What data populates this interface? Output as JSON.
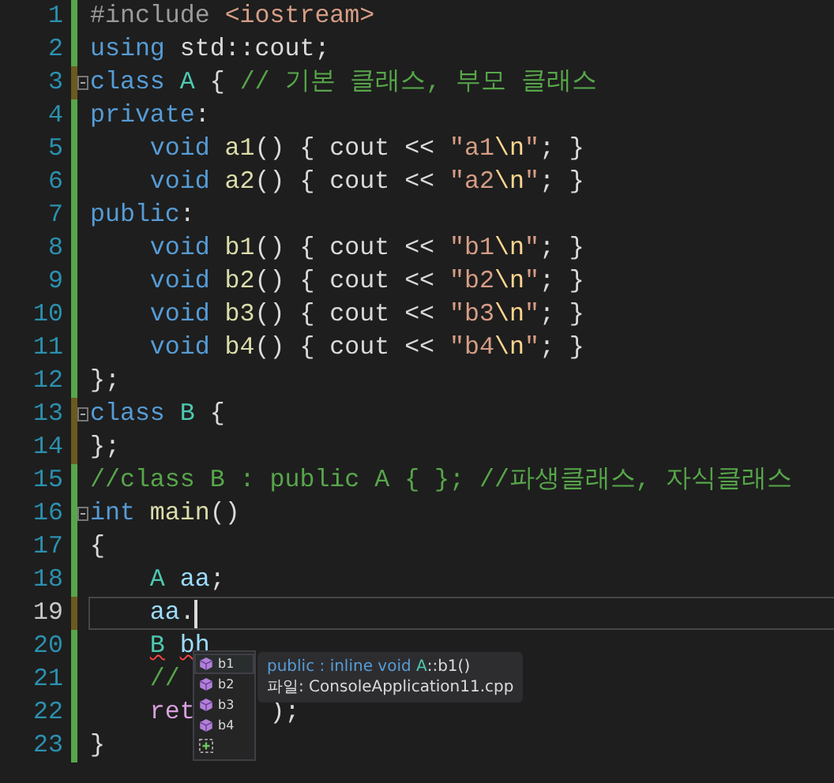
{
  "editor": {
    "lines": [
      {
        "number": "1",
        "saved": true,
        "fold": false,
        "current": false,
        "indent": false,
        "tokens": [
          {
            "text": "#include",
            "kind": "pre"
          },
          {
            "text": " <iostream>",
            "kind": "string"
          }
        ]
      },
      {
        "number": "2",
        "saved": true,
        "fold": false,
        "current": false,
        "indent": false,
        "tokens": [
          {
            "text": "using",
            "kind": "keyword"
          },
          {
            "text": " std::cout;",
            "kind": "plain"
          }
        ]
      },
      {
        "number": "3",
        "saved": false,
        "fold": true,
        "current": false,
        "indent": false,
        "tokens": [
          {
            "text": "class",
            "kind": "keyword"
          },
          {
            "text": " A",
            "kind": "type"
          },
          {
            "text": " { ",
            "kind": "plain"
          },
          {
            "text": "// 기본 클래스, 부모 클래스",
            "kind": "comment"
          }
        ]
      },
      {
        "number": "4",
        "saved": true,
        "fold": false,
        "current": false,
        "indent": false,
        "tokens": [
          {
            "text": "private",
            "kind": "keyword"
          },
          {
            "text": ":",
            "kind": "plain"
          }
        ]
      },
      {
        "number": "5",
        "saved": true,
        "fold": false,
        "current": false,
        "indent": true,
        "tokens": [
          {
            "text": "void",
            "kind": "keyword"
          },
          {
            "text": " a1",
            "kind": "function"
          },
          {
            "text": "() { cout << ",
            "kind": "plain"
          },
          {
            "text": "\"a1",
            "kind": "string"
          },
          {
            "text": "\\n",
            "kind": "escape"
          },
          {
            "text": "\"",
            "kind": "string"
          },
          {
            "text": "; }",
            "kind": "plain"
          }
        ]
      },
      {
        "number": "6",
        "saved": true,
        "fold": false,
        "current": false,
        "indent": true,
        "tokens": [
          {
            "text": "void",
            "kind": "keyword"
          },
          {
            "text": " a2",
            "kind": "function"
          },
          {
            "text": "() { cout << ",
            "kind": "plain"
          },
          {
            "text": "\"a2",
            "kind": "string"
          },
          {
            "text": "\\n",
            "kind": "escape"
          },
          {
            "text": "\"",
            "kind": "string"
          },
          {
            "text": "; }",
            "kind": "plain"
          }
        ]
      },
      {
        "number": "7",
        "saved": true,
        "fold": false,
        "current": false,
        "indent": false,
        "tokens": [
          {
            "text": "public",
            "kind": "keyword"
          },
          {
            "text": ":",
            "kind": "plain"
          }
        ]
      },
      {
        "number": "8",
        "saved": true,
        "fold": false,
        "current": false,
        "indent": true,
        "tokens": [
          {
            "text": "void",
            "kind": "keyword"
          },
          {
            "text": " b1",
            "kind": "function"
          },
          {
            "text": "() { cout << ",
            "kind": "plain"
          },
          {
            "text": "\"b1",
            "kind": "string"
          },
          {
            "text": "\\n",
            "kind": "escape"
          },
          {
            "text": "\"",
            "kind": "string"
          },
          {
            "text": "; }",
            "kind": "plain"
          }
        ]
      },
      {
        "number": "9",
        "saved": true,
        "fold": false,
        "current": false,
        "indent": true,
        "tokens": [
          {
            "text": "void",
            "kind": "keyword"
          },
          {
            "text": " b2",
            "kind": "function"
          },
          {
            "text": "() { cout << ",
            "kind": "plain"
          },
          {
            "text": "\"b2",
            "kind": "string"
          },
          {
            "text": "\\n",
            "kind": "escape"
          },
          {
            "text": "\"",
            "kind": "string"
          },
          {
            "text": "; }",
            "kind": "plain"
          }
        ]
      },
      {
        "number": "10",
        "saved": true,
        "fold": false,
        "current": false,
        "indent": true,
        "tokens": [
          {
            "text": "void",
            "kind": "keyword"
          },
          {
            "text": " b3",
            "kind": "function"
          },
          {
            "text": "() { cout << ",
            "kind": "plain"
          },
          {
            "text": "\"b3",
            "kind": "string"
          },
          {
            "text": "\\n",
            "kind": "escape"
          },
          {
            "text": "\"",
            "kind": "string"
          },
          {
            "text": "; }",
            "kind": "plain"
          }
        ]
      },
      {
        "number": "11",
        "saved": true,
        "fold": false,
        "current": false,
        "indent": true,
        "tokens": [
          {
            "text": "void",
            "kind": "keyword"
          },
          {
            "text": " b4",
            "kind": "function"
          },
          {
            "text": "() { cout << ",
            "kind": "plain"
          },
          {
            "text": "\"b4",
            "kind": "string"
          },
          {
            "text": "\\n",
            "kind": "escape"
          },
          {
            "text": "\"",
            "kind": "string"
          },
          {
            "text": "; }",
            "kind": "plain"
          }
        ]
      },
      {
        "number": "12",
        "saved": true,
        "fold": false,
        "current": false,
        "indent": false,
        "tokens": [
          {
            "text": "};",
            "kind": "plain"
          }
        ]
      },
      {
        "number": "13",
        "saved": false,
        "fold": true,
        "current": false,
        "indent": false,
        "tokens": [
          {
            "text": "class",
            "kind": "keyword"
          },
          {
            "text": " B",
            "kind": "type"
          },
          {
            "text": " {",
            "kind": "plain"
          }
        ]
      },
      {
        "number": "14",
        "saved": false,
        "fold": false,
        "current": false,
        "indent": false,
        "tokens": [
          {
            "text": "};",
            "kind": "plain"
          }
        ]
      },
      {
        "number": "15",
        "saved": true,
        "fold": false,
        "current": false,
        "indent": false,
        "tokens": [
          {
            "text": "//class B : public A { }; //파생클래스, 자식클래스",
            "kind": "comment"
          }
        ]
      },
      {
        "number": "16",
        "saved": true,
        "fold": true,
        "current": false,
        "indent": false,
        "tokens": [
          {
            "text": "int",
            "kind": "keyword"
          },
          {
            "text": " main",
            "kind": "function"
          },
          {
            "text": "()",
            "kind": "plain"
          }
        ]
      },
      {
        "number": "17",
        "saved": true,
        "fold": false,
        "current": false,
        "indent": false,
        "tokens": [
          {
            "text": "{",
            "kind": "plain"
          }
        ]
      },
      {
        "number": "18",
        "saved": true,
        "fold": false,
        "current": false,
        "indent": true,
        "tokens": [
          {
            "text": "A",
            "kind": "type"
          },
          {
            "text": " aa",
            "kind": "variable"
          },
          {
            "text": ";",
            "kind": "plain"
          }
        ]
      },
      {
        "number": "19",
        "saved": false,
        "fold": false,
        "current": true,
        "indent": true,
        "tokens": [
          {
            "text": "aa",
            "kind": "variable"
          },
          {
            "text": ".",
            "kind": "plain"
          }
        ]
      },
      {
        "number": "20",
        "saved": true,
        "fold": false,
        "current": false,
        "indent": true,
        "tokens": [
          {
            "text": "B",
            "kind": "type",
            "error": true
          },
          {
            "text": "bh",
            "kind": "variable",
            "error": true,
            "spaced": true
          }
        ]
      },
      {
        "number": "21",
        "saved": true,
        "fold": false,
        "current": false,
        "indent": true,
        "tokens": [
          {
            "text": "//",
            "kind": "comment"
          }
        ]
      },
      {
        "number": "22",
        "saved": true,
        "fold": false,
        "current": false,
        "indent": true,
        "tokens": [
          {
            "text": "ret",
            "kind": "control"
          },
          {
            "text": ");",
            "kind": "plain",
            "covered_before": true
          }
        ]
      },
      {
        "number": "23",
        "saved": true,
        "fold": false,
        "current": false,
        "indent": false,
        "tokens": [
          {
            "text": "}",
            "kind": "plain"
          }
        ]
      }
    ]
  },
  "completion": {
    "items": [
      {
        "kind": "method",
        "label": "b1",
        "selected": true
      },
      {
        "kind": "method",
        "label": "b2",
        "selected": false
      },
      {
        "kind": "method",
        "label": "b3",
        "selected": false
      },
      {
        "kind": "method",
        "label": "b4",
        "selected": false
      },
      {
        "kind": "snippet",
        "selected": false
      }
    ]
  },
  "tooltip": {
    "signature": [
      {
        "text": "public : inline void ",
        "kind": "keyword"
      },
      {
        "text": "A",
        "kind": "type"
      },
      {
        "text": "::b1()",
        "kind": "plain"
      }
    ],
    "file": "파일: ConsoleApplication11.cpp"
  }
}
